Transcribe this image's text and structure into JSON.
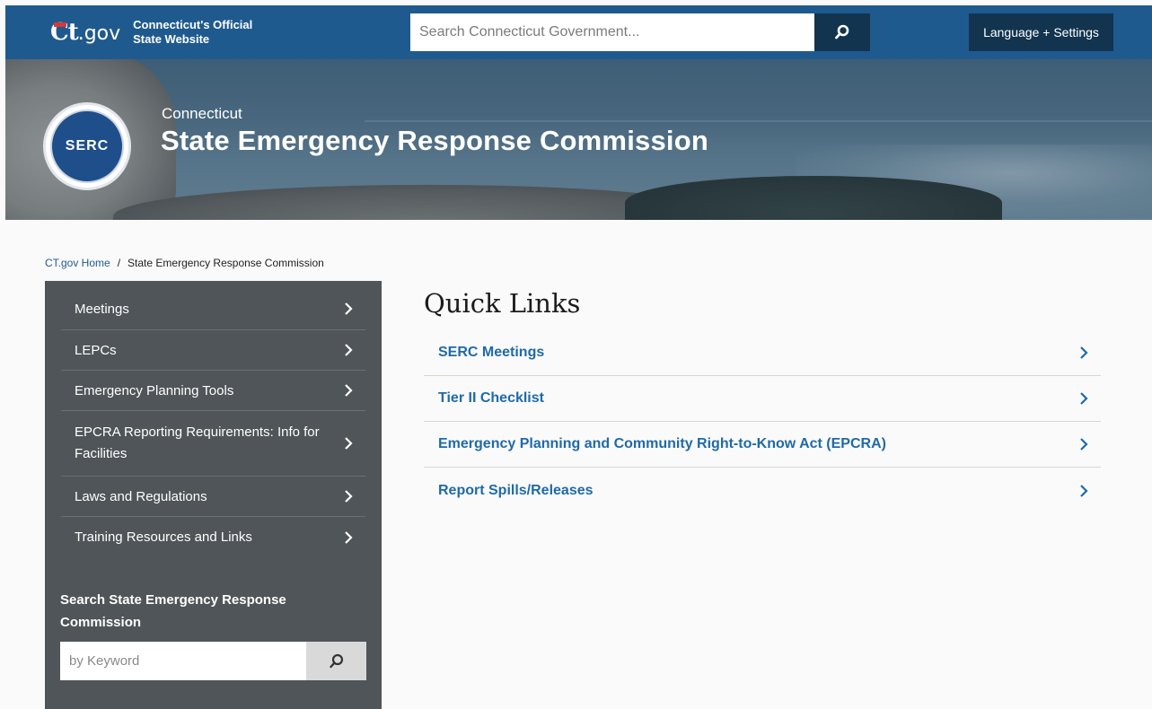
{
  "header": {
    "logo_text": "Ct",
    "logo_gov": ".gov",
    "brand_line1": "Connecticut's Official",
    "brand_line2": "State Website",
    "search_placeholder": "Search Connecticut Government...",
    "language_button": "Language + Settings"
  },
  "hero": {
    "seal_text": "SERC",
    "subtitle": "Connecticut",
    "title": "State Emergency Response Commission"
  },
  "breadcrumb": {
    "home": "CT.gov Home",
    "separator": "/",
    "current": "State Emergency Response Commission"
  },
  "sidebar": {
    "items": [
      {
        "label": "Meetings"
      },
      {
        "label": "LEPCs"
      },
      {
        "label": "Emergency Planning Tools"
      },
      {
        "label": "EPCRA Reporting Requirements: Info for Facilities"
      },
      {
        "label": "Laws and Regulations"
      },
      {
        "label": "Training Resources and Links"
      }
    ],
    "search_title": "Search State Emergency Response Commission",
    "search_placeholder": "by Keyword"
  },
  "main": {
    "title": "Quick Links",
    "links": [
      {
        "label": "SERC Meetings"
      },
      {
        "label": "Tier II Checklist"
      },
      {
        "label": "Emergency Planning and Community Right-to-Know Act (EPCRA)"
      },
      {
        "label": "Report Spills/Releases"
      }
    ]
  },
  "colors": {
    "topbar": "#1f5a8f",
    "dark_button": "#12344f",
    "sidebar": "#4f5558",
    "link": "#1f6aa8"
  },
  "icons": {
    "search": "search-icon",
    "chevron": "chevron-right-icon"
  }
}
